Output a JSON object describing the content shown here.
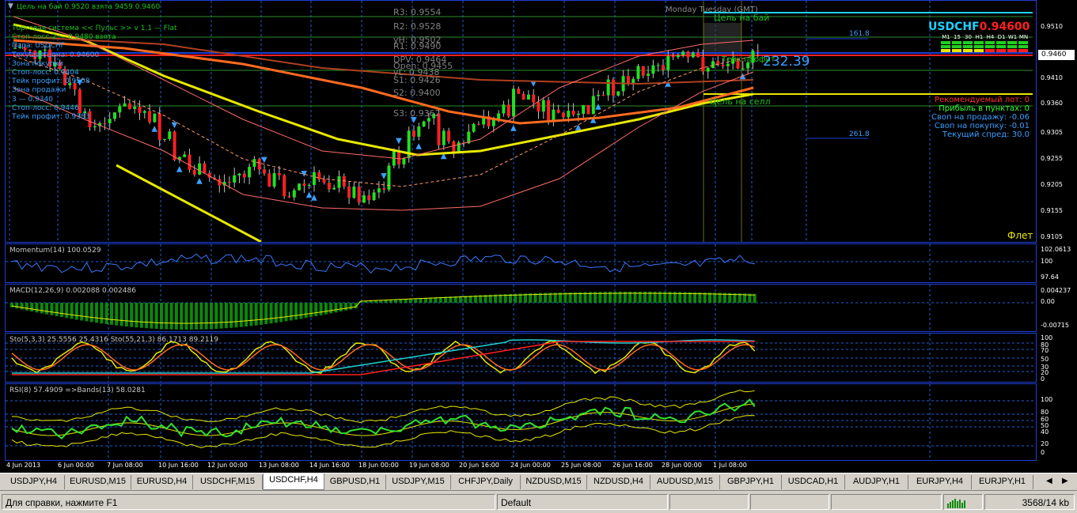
{
  "window": {
    "symbol_tf": "USDCHF,H4",
    "ea_header": "Цель на бай 0.9520 взята 9459 0.9460"
  },
  "main_chart": {
    "symbol": "USDCHF",
    "price": "0.94600",
    "current_price_label": "0.9460",
    "info_box": [
      "Торговая система << Пульс >> v 1.1 — Flat",
      "Стоп-лосс-2 — 0.9480 взята",
      "Пара: USDCHF",
      "Текущая цена: 0.94600",
      "Зона покупки",
      "Стоп-лосс: 0.9404",
      "Тейк профит: 0.9508",
      "Зона продажи",
      "3 — 0.9340",
      "Стоп-лосс: 0.9446",
      "Тейк профит: 0.9383"
    ],
    "pivots": [
      {
        "label": "R3: 0.9554",
        "color": "#808080"
      },
      {
        "label": "R2: 0.9528",
        "color": "#808080"
      },
      {
        "label": "yH: 0.9502",
        "color": "#808080"
      },
      {
        "label": "R1: 0.9490",
        "color": "#808080"
      },
      {
        "label": "DPV: 0.9464",
        "color": "#808080"
      },
      {
        "label": "Open: 0.9455",
        "color": "#808080"
      },
      {
        "label": "yL: 0.9438",
        "color": "#808080"
      },
      {
        "label": "S1: 0.9426",
        "color": "#808080"
      },
      {
        "label": "S2: 0.9400",
        "color": "#808080"
      },
      {
        "label": "S3: 0.9362",
        "color": "#808080"
      }
    ],
    "day_labels": "Monday Tuesday   (GMT)",
    "buy_target": "Цель на бай",
    "sell_target": "Цель на селл",
    "tp_label": "Тейк профит",
    "big_number": "232.39",
    "fib_161": "161.8",
    "fib_261": "261.8",
    "flat_label": "Флет",
    "timeframe_labels": [
      "M1",
      "15",
      "30",
      "H1",
      "H4",
      "D1",
      "W1",
      "MN"
    ],
    "stats": [
      {
        "text": "Рекомендуемый лот: 0",
        "color": "#ff3030"
      },
      {
        "text": "Прибыль в пунктах: 0",
        "color": "#30ff30"
      },
      {
        "text": "Своп на продажу: -0.06",
        "color": "#3aa0ff"
      },
      {
        "text": "Своп на покупку: -0.01",
        "color": "#3aa0ff"
      },
      {
        "text": "Текущий спред: 30.0",
        "color": "#3aa0ff"
      }
    ],
    "y_ticks": [
      "0.9510",
      "0.9460",
      "0.9410",
      "0.9360",
      "0.9305",
      "0.9255",
      "0.9205",
      "0.9155",
      "0.9105"
    ]
  },
  "momentum": {
    "title": "Momentum(14) 100.0529",
    "y_ticks": [
      "102.0613",
      "100",
      "97.64"
    ]
  },
  "macd": {
    "title": "MACD(12,26,9) 0.002088 0.002486",
    "y_ticks": [
      "0.004237",
      "0.00",
      "-0.00715"
    ]
  },
  "stoch": {
    "title": "Sto(5,3,3) 25.5556 25.4316  Sto(55,21,3) 86.1713 89.2119",
    "y_ticks": [
      "100",
      "80",
      "70",
      "50",
      "30",
      "20",
      "0"
    ]
  },
  "rsi": {
    "title": "RSI(8) 57.4909  =>Bands(13) 58.0281",
    "y_ticks": [
      "100",
      "80",
      "60",
      "50",
      "40",
      "20",
      "0"
    ]
  },
  "time_axis": [
    "4 Jun 2013",
    "6 Jun 00:00",
    "7 Jun 08:00",
    "10 Jun 16:00",
    "12 Jun 00:00",
    "13 Jun 08:00",
    "14 Jun 16:00",
    "18 Jun 00:00",
    "19 Jun 08:00",
    "20 Jun 16:00",
    "24 Jun 00:00",
    "25 Jun 08:00",
    "26 Jun 16:00",
    "28 Jun 00:00",
    "1 Jul 08:00"
  ],
  "tabs": [
    "USDJPY,H4",
    "EURUSD,M15",
    "EURUSD,H4",
    "USDCHF,M15",
    "USDCHF,H4",
    "GBPUSD,H1",
    "USDJPY,M15",
    "CHFJPY,Daily",
    "NZDUSD,M15",
    "NZDUSD,H4",
    "AUDUSD,M15",
    "GBPJPY,H1",
    "USDCAD,H1",
    "AUDJPY,H1",
    "EURJPY,H4",
    "EURJPY,H1"
  ],
  "active_tab": 4,
  "status": {
    "help": "Для справки, нажмите F1",
    "profile": "Default",
    "traffic": "3568/14 kb"
  }
}
